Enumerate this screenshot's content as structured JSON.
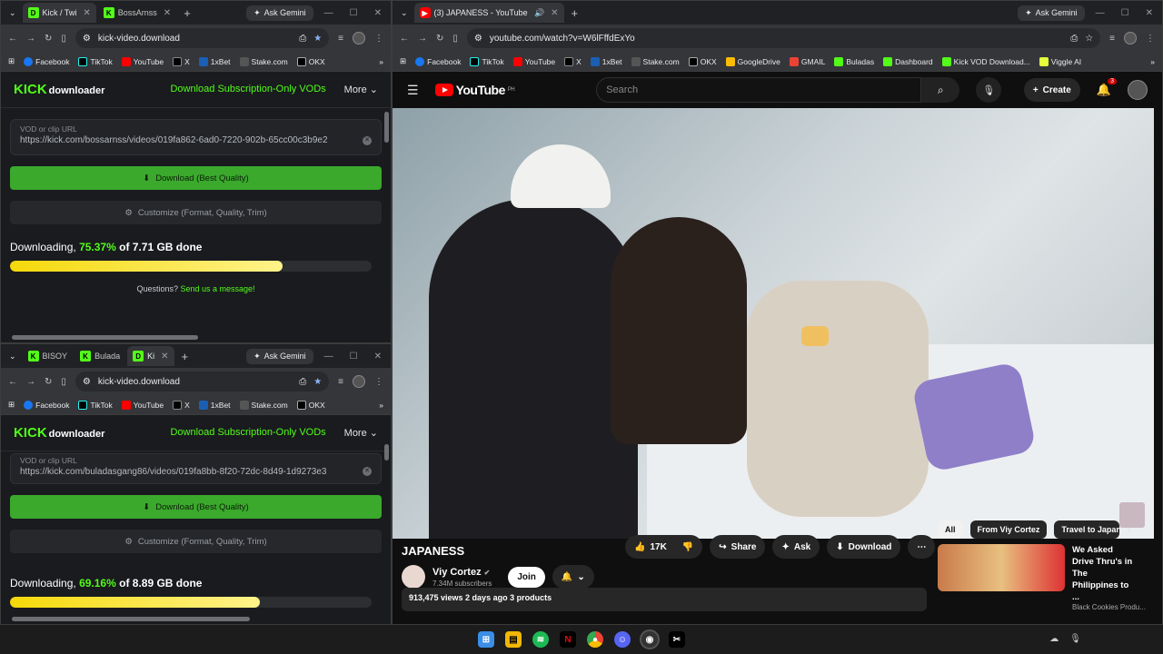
{
  "win1": {
    "tabs": [
      {
        "label": "Kick / Twi",
        "icon": "D"
      },
      {
        "label": "BossArnss",
        "icon": "K"
      }
    ],
    "gemini": "Ask Gemini",
    "url": "kick-video.download",
    "bookmarks": [
      "Facebook",
      "TikTok",
      "YouTube",
      "X",
      "1xBet",
      "Stake.com",
      "OKX"
    ],
    "page": {
      "logo_main": "KICK",
      "logo_sub": "downloader",
      "nav_link": "Download Subscription-Only VODs",
      "nav_more": "More",
      "url_label": "VOD or clip URL",
      "url_value": "https://kick.com/bossarnss/videos/019fa862-6ad0-7220-902b-65cc00c3b9e2",
      "download_label": "Download (Best Quality)",
      "customize_label": "Customize (Format, Quality, Trim)",
      "status_prefix": "Downloading,",
      "status_pct": "75.37%",
      "status_suffix": "of 7.71 GB done",
      "progress": 0.7537,
      "question": "Questions?",
      "question_link": "Send us a message!"
    }
  },
  "win2": {
    "tabs": [
      {
        "label": "BISOY",
        "icon": "K"
      },
      {
        "label": "Bulada",
        "icon": "K"
      },
      {
        "label": "Ki",
        "icon": "D"
      }
    ],
    "gemini": "Ask Gemini",
    "url": "kick-video.download",
    "bookmarks": [
      "Facebook",
      "TikTok",
      "YouTube",
      "X",
      "1xBet",
      "Stake.com",
      "OKX"
    ],
    "page": {
      "logo_main": "KICK",
      "logo_sub": "downloader",
      "nav_link": "Download Subscription-Only VODs",
      "nav_more": "More",
      "url_label": "VOD or clip URL",
      "url_value": "https://kick.com/buladasgang86/videos/019fa8bb-8f20-72dc-8d49-1d9273e3",
      "download_label": "Download (Best Quality)",
      "customize_label": "Customize (Format, Quality, Trim)",
      "status_prefix": "Downloading,",
      "status_pct": "69.16%",
      "status_suffix": "of 8.89 GB done",
      "progress": 0.6916
    }
  },
  "win3": {
    "tab": "(3) JAPANESS - YouTube",
    "gemini": "Ask Gemini",
    "url": "youtube.com/watch?v=W6lFffdExYo",
    "bookmarks": [
      "Facebook",
      "TikTok",
      "YouTube",
      "X",
      "1xBet",
      "Stake.com",
      "OKX",
      "GoogleDrive",
      "GMAIL",
      "Buladas",
      "Dashboard",
      "Kick VOD Download...",
      "Viggle AI"
    ],
    "yt": {
      "logo": "YouTube",
      "region": "PH",
      "search_placeholder": "Search",
      "create": "Create",
      "notif_count": "3",
      "title": "JAPANESS",
      "channel": "Viy Cortez",
      "subs": "7.34M subscribers",
      "join": "Join",
      "likes": "17K",
      "share": "Share",
      "ask": "Ask",
      "download": "Download",
      "meta": "913,475 views  2 days ago  3 products",
      "chips": [
        "All",
        "From Viy Cortez",
        "Travel to Japan"
      ],
      "rec_title": "We Asked Drive Thru's in The Philippines to ...",
      "rec_channel": "Black Cookies Produ..."
    }
  },
  "colors": {
    "kick_green": "#53fc18",
    "yt_red": "#ff0000",
    "progress_yellow": "#f5d90a"
  }
}
